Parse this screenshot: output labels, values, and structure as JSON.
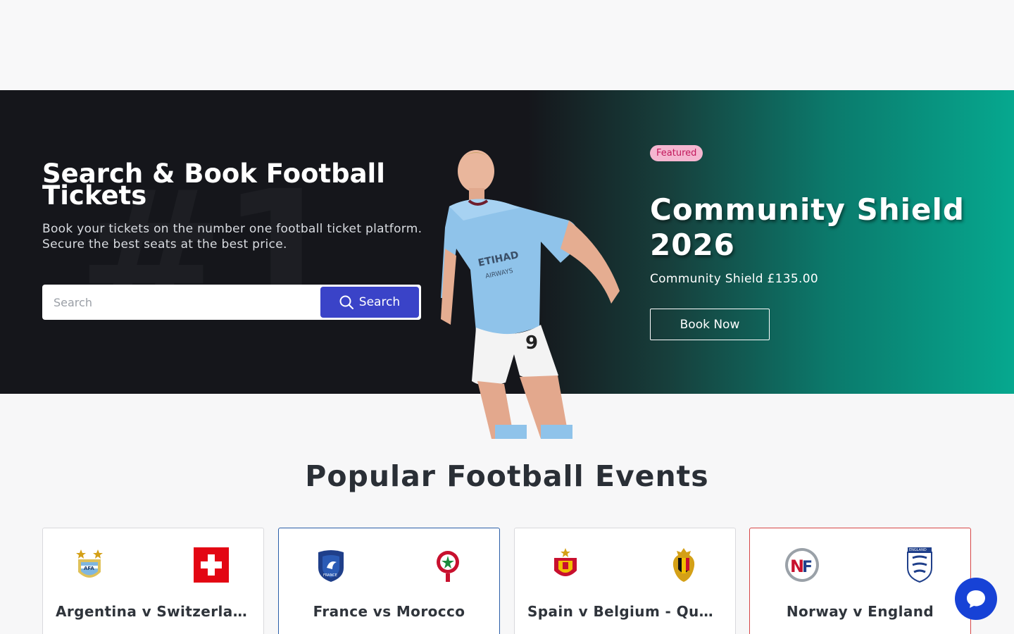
{
  "hero": {
    "watermark": "#1",
    "title": "Search & Book Football Tickets",
    "subtitle": "Book your tickets on the number one football ticket platform. Secure the best seats at the best price.",
    "search_placeholder": "Search",
    "search_button": "Search"
  },
  "featured": {
    "badge": "Featured",
    "title": "Community Shield 2026",
    "subtitle": "Community Shield £135.00",
    "button": "Book Now"
  },
  "popular": {
    "title": "Popular Football Events",
    "events": [
      {
        "title": "Argentina v Switzerland",
        "home_crest": "argentina-crest",
        "away_crest": "switzerland-flag"
      },
      {
        "title": "France vs Morocco",
        "home_crest": "france-crest",
        "away_crest": "morocco-crest"
      },
      {
        "title": "Spain v Belgium - Quarter Final",
        "home_crest": "spain-crest",
        "away_crest": "belgium-crest"
      },
      {
        "title": "Norway v England",
        "home_crest": "norway-crest",
        "away_crest": "england-crest"
      }
    ]
  },
  "colors": {
    "search_button": "#3a43c8",
    "featured_badge_bg": "#f5b6d0",
    "featured_badge_text": "#c2185b",
    "chat_button": "#1742d6"
  },
  "icons": {
    "search": "search-icon",
    "chat": "chat-bubble-icon"
  }
}
